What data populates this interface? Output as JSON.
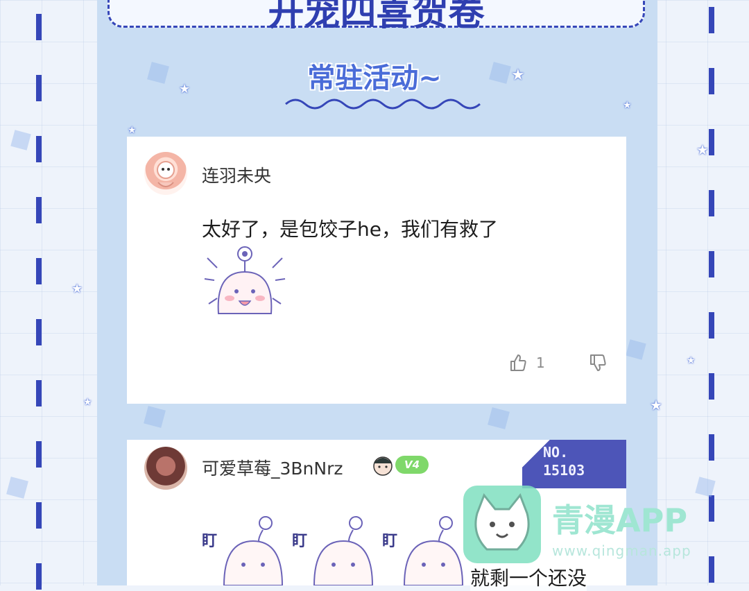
{
  "header": {
    "title_fragment": "开宠四喜贺卷"
  },
  "section": {
    "title": "常驻活动~"
  },
  "comments": [
    {
      "username": "连羽未央",
      "text": "太好了，是包饺子he，我们有救了",
      "sticker": "mochi-excited-sticker",
      "likes": "1"
    },
    {
      "username": "可爱草莓_3BnNrz",
      "level_badge": "V4",
      "card_deco_text_1": "NO.",
      "card_deco_text_2": "15103",
      "sticker_labels": [
        "盯",
        "盯",
        "盯"
      ]
    }
  ],
  "watermark": {
    "title": "青漫APP",
    "url": "www.qingman.app",
    "caption_text": "就剩一个还没"
  },
  "colors": {
    "accent": "#3546b8",
    "panel": "#c9ddf3",
    "badge": "#7fd86a"
  }
}
